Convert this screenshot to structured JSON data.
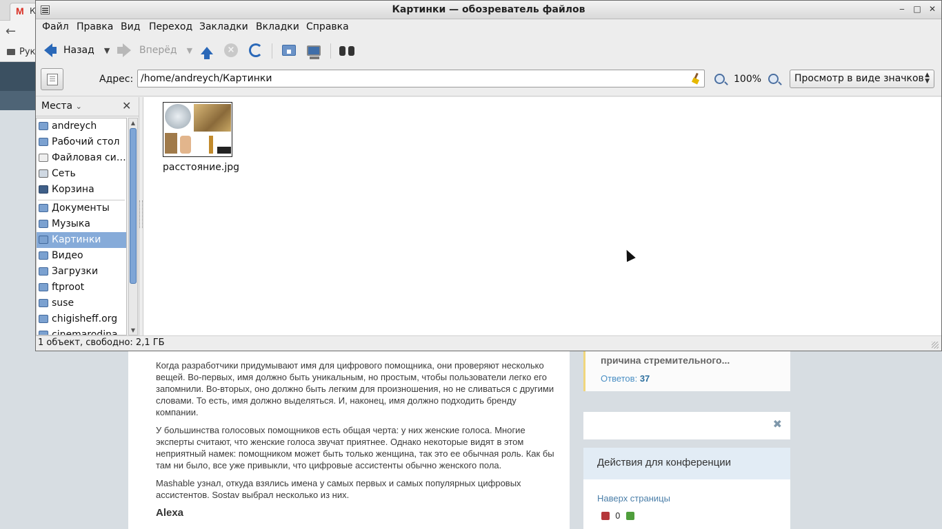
{
  "background": {
    "tab_title": "К",
    "tab_icon": "gmail-icon",
    "bookmark_label": "Рук",
    "article": {
      "paragraphs": [
        "Когда разработчики придумывают имя для цифрового помощника, они проверяют несколько вещей. Во-первых, имя должно быть уникальным, но простым, чтобы пользователи легко его запомнили. Во-вторых, оно должно быть легким для произношения, но не сливаться с другими словами. То есть, имя должно выделяться. И, наконец, имя должно подходить бренду компании.",
        "У большинства голосовых помощников есть общая черта: у них женские голоса. Многие эксперты считают, что женские голоса звучат приятнее. Однако некоторые видят в этом неприятный намек: помощником может быть только женщина, так это ее обычная роль. Как бы там ни было, все уже привыкли, что цифровые ассистенты обычно женского пола.",
        "Mashable узнал, откуда взялись имена у самых первых и самых популярных цифровых ассистентов. Sostav выбрал несколько из них."
      ],
      "heading": "Alexa"
    },
    "question_card": {
      "title": "причина стремительного...",
      "answers_label": "Ответов:",
      "answers_count": "37"
    },
    "conference": {
      "header": "Действия для конференции",
      "link": "Наверх страницы",
      "votes": "0"
    }
  },
  "window": {
    "title": "Картинки — обозреватель файлов",
    "menu": [
      "Файл",
      "Правка",
      "Вид",
      "Переход",
      "Закладки",
      "Вкладки",
      "Справка"
    ],
    "toolbar": {
      "back_label": "Назад",
      "forward_label": "Вперёд"
    },
    "address": {
      "label": "Адрес:",
      "value": "/home/andreych/Картинки"
    },
    "zoom": "100%",
    "view_mode": "Просмотр в виде значков",
    "sidebar": {
      "title": "Места",
      "items": [
        {
          "label": "andreych",
          "icon": "home-folder-icon"
        },
        {
          "label": "Рабочий стол",
          "icon": "desktop-folder-icon"
        },
        {
          "label": "Файловая си…",
          "icon": "filesystem-icon"
        },
        {
          "label": "Сеть",
          "icon": "network-icon"
        },
        {
          "label": "Корзина",
          "icon": "trash-icon"
        },
        {
          "label": "Документы",
          "icon": "documents-folder-icon"
        },
        {
          "label": "Музыка",
          "icon": "music-folder-icon"
        },
        {
          "label": "Картинки",
          "icon": "pictures-folder-icon",
          "selected": true
        },
        {
          "label": "Видео",
          "icon": "videos-folder-icon"
        },
        {
          "label": "Загрузки",
          "icon": "downloads-folder-icon"
        },
        {
          "label": "ftproot",
          "icon": "folder-icon"
        },
        {
          "label": "suse",
          "icon": "folder-icon"
        },
        {
          "label": "chigisheff.org",
          "icon": "folder-icon"
        },
        {
          "label": "cinemarodina",
          "icon": "folder-icon"
        }
      ]
    },
    "files": [
      {
        "name": "расстояние.jpg"
      }
    ],
    "status": "1 объект, свободно: 2,1 ГБ"
  }
}
